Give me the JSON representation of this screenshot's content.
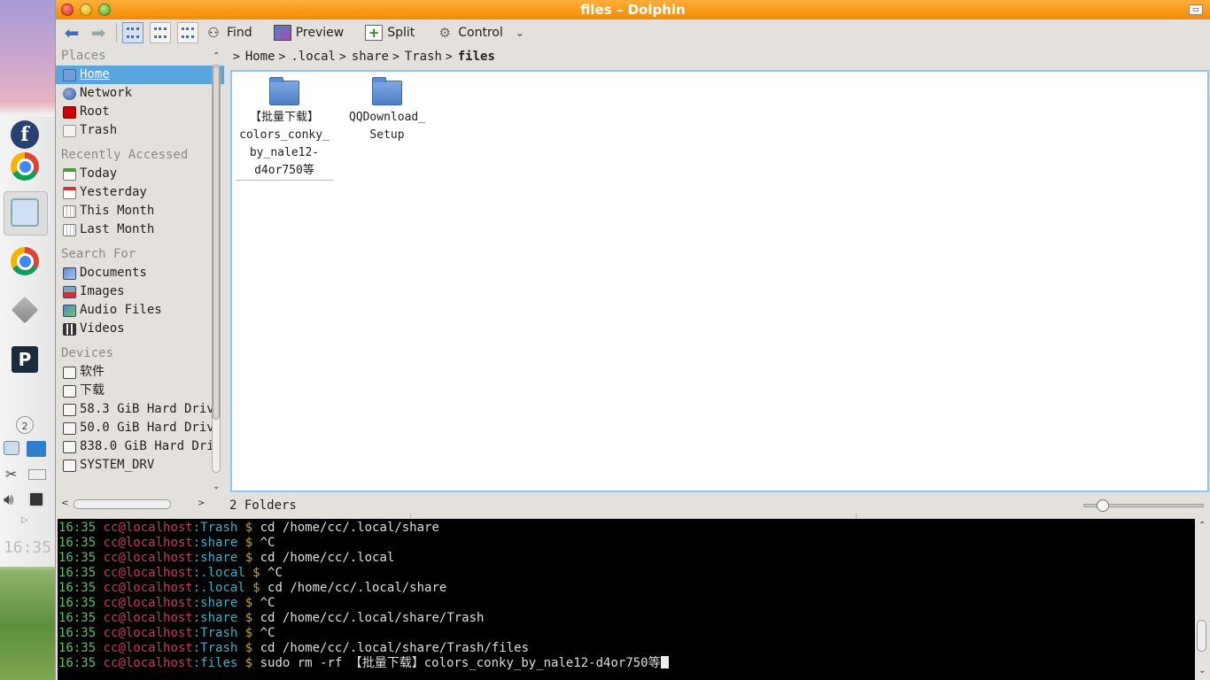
{
  "window": {
    "title": "files – Dolphin"
  },
  "dock": {
    "clock": "16:35",
    "tray_badge": "2"
  },
  "toolbar": {
    "find": "Find",
    "preview": "Preview",
    "split": "Split",
    "control": "Control"
  },
  "places": {
    "sections": [
      {
        "header": "Places",
        "items": [
          {
            "label": "Home",
            "icon": "home-icon"
          },
          {
            "label": "Network",
            "icon": "network-icon"
          },
          {
            "label": "Root",
            "icon": "root-icon"
          },
          {
            "label": "Trash",
            "icon": "trash-icon"
          }
        ]
      },
      {
        "header": "Recently Accessed",
        "items": [
          {
            "label": "Today"
          },
          {
            "label": "Yesterday"
          },
          {
            "label": "This Month"
          },
          {
            "label": "Last Month"
          }
        ]
      },
      {
        "header": "Search For",
        "items": [
          {
            "label": "Documents"
          },
          {
            "label": "Images"
          },
          {
            "label": "Audio Files"
          },
          {
            "label": "Videos"
          }
        ]
      },
      {
        "header": "Devices",
        "items": [
          {
            "label": "软件"
          },
          {
            "label": "下载"
          },
          {
            "label": "58.3 GiB Hard Driv"
          },
          {
            "label": "50.0 GiB Hard Driv"
          },
          {
            "label": "838.0 GiB Hard Dri"
          },
          {
            "label": "SYSTEM_DRV"
          }
        ]
      }
    ],
    "selected": "Home"
  },
  "breadcrumb": [
    "Home",
    ".local",
    "share",
    "Trash",
    "files"
  ],
  "files": [
    {
      "name_lines": [
        "【批量下载】",
        "colors_conky_",
        "by_nale12-",
        "d4or750等"
      ],
      "icon": "folder-icon"
    },
    {
      "name_lines": [
        "QQDownload_",
        "Setup"
      ],
      "icon": "folder-icon"
    }
  ],
  "status": {
    "text": "2 Folders"
  },
  "terminal": {
    "lines": [
      {
        "time": "16:35",
        "user": "cc",
        "host": "@localhost",
        "dir": "Trash",
        "cmd": "cd /home/cc/.local/share"
      },
      {
        "time": "16:35",
        "user": "cc",
        "host": "@localhost",
        "dir": "share",
        "cmd": "^C"
      },
      {
        "time": "16:35",
        "user": "cc",
        "host": "@localhost",
        "dir": "share",
        "cmd": "cd /home/cc/.local"
      },
      {
        "time": "16:35",
        "user": "cc",
        "host": "@localhost",
        "dir": ".local",
        "cmd": "^C"
      },
      {
        "time": "16:35",
        "user": "cc",
        "host": "@localhost",
        "dir": ".local",
        "cmd": "cd /home/cc/.local/share"
      },
      {
        "time": "16:35",
        "user": "cc",
        "host": "@localhost",
        "dir": "share",
        "cmd": "^C"
      },
      {
        "time": "16:35",
        "user": "cc",
        "host": "@localhost",
        "dir": "share",
        "cmd": "cd /home/cc/.local/share/Trash"
      },
      {
        "time": "16:35",
        "user": "cc",
        "host": "@localhost",
        "dir": "Trash",
        "cmd": "^C"
      },
      {
        "time": "16:35",
        "user": "cc",
        "host": "@localhost",
        "dir": "Trash",
        "cmd": "cd /home/cc/.local/share/Trash/files"
      },
      {
        "time": "16:35",
        "user": "cc",
        "host": "@localhost",
        "dir": "files",
        "cmd": "sudo rm -rf 【批量下载】colors_conky_by_nale12-d4or750等"
      }
    ]
  },
  "colors": {
    "titlebar": "#f28b00",
    "selection": "#5aa4e0",
    "view_border": "#8cc6ff"
  }
}
